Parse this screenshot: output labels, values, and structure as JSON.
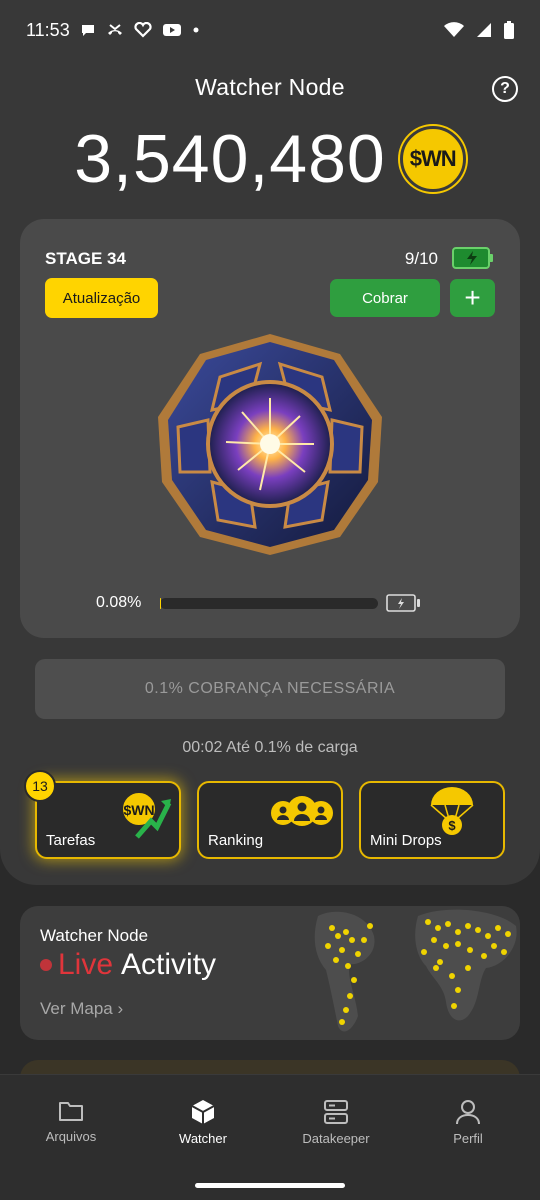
{
  "status_bar": {
    "time": "11:53"
  },
  "header": {
    "title": "Watcher Node",
    "balance": "3,540,480",
    "coin_symbol": "$WN"
  },
  "stage_card": {
    "stage_label": "STAGE 34",
    "count": "9/10",
    "upgrade_label": "Atualização",
    "collect_label": "Cobrar",
    "add_label": "+",
    "progress_text": "0.08%",
    "progress_fraction": 0.0008
  },
  "charge_button": {
    "label": "0.1% COBRANÇA NECESSÁRIA"
  },
  "timer": {
    "text": "00:02 Até 0.1% de carga"
  },
  "tiles": [
    {
      "label": "Tarefas",
      "badge": "13",
      "icon": "wn-coin-chart-icon"
    },
    {
      "label": "Ranking",
      "icon": "users-group-icon"
    },
    {
      "label": "Mini Drops",
      "icon": "parachute-coin-icon"
    }
  ],
  "live_card": {
    "small_title": "Watcher Node",
    "live_word": "Live",
    "activity_word": "Activity",
    "link_label": "Ver Mapa"
  },
  "bottom_nav": [
    {
      "label": "Arquivos",
      "icon": "folder-icon"
    },
    {
      "label": "Watcher",
      "icon": "cube-icon",
      "active": true
    },
    {
      "label": "Datakeeper",
      "icon": "server-icon"
    },
    {
      "label": "Perfil",
      "icon": "person-icon"
    }
  ],
  "colors": {
    "accent_yellow": "#ffd400",
    "accent_green": "#2f9e3f",
    "live_red": "#e0353b",
    "background": "#2a2a2a"
  }
}
